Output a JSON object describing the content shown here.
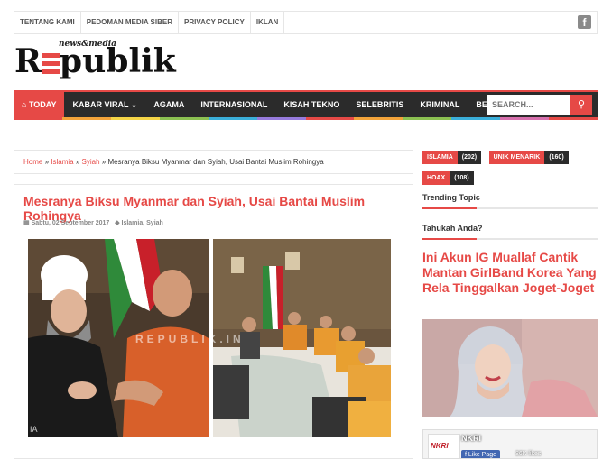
{
  "top_links": [
    "TENTANG KAMI",
    "PEDOMAN MEDIA SIBER",
    "PRIVACY POLICY",
    "IKLAN"
  ],
  "facebook_icon": "facebook-icon",
  "logo": {
    "tagline": "news&media",
    "name_prefix": "R",
    "name_suffix": "publik"
  },
  "nav": {
    "today": "TODAY",
    "items": [
      "KABAR VIRAL",
      "AGAMA",
      "INTERNASIONAL",
      "KISAH TEKNO",
      "SELEBRITIS",
      "KRIMINAL",
      "BERITA HOAX"
    ],
    "search_placeholder": "SEARCH..."
  },
  "rainbow_colors": [
    "#e64946",
    "#f2a33a",
    "#f5d547",
    "#8cc152",
    "#3bafda",
    "#967adc",
    "#e64946",
    "#f2a33a",
    "#8cc152",
    "#3bafda",
    "#d770ad",
    "#e64946"
  ],
  "breadcrumb": {
    "home": "Home",
    "sep": "»",
    "cat1": "Islamia",
    "cat2": "Syiah",
    "current": "Mesranya Biksu Myanmar dan Syiah, Usai Bantai Muslim Rohingya"
  },
  "article": {
    "title": "Mesranya Biksu Myanmar dan Syiah, Usai Bantai Muslim Rohingya",
    "date": "Sabtu, 02 September 2017",
    "tags": "Islamia, Syiah",
    "watermark": "REPUBLIK.IN",
    "corner_mark": "IA"
  },
  "sidebar": {
    "tags": [
      {
        "name": "ISLAMIA",
        "count": "(202)"
      },
      {
        "name": "UNIK MENARIK",
        "count": "(160)"
      },
      {
        "name": "HOAX",
        "count": "(108)"
      }
    ],
    "trending": "Trending Topic",
    "tahukah": "Tahukah Anda?",
    "featured_title": "Ini Akun IG Muallaf Cantik Mantan GirlBand Korea Yang Rela Tinggalkan Joget-Joget",
    "fb_page": {
      "name": "NKRI",
      "like": "Like Page",
      "likes": "86K likes",
      "logo_text": "NKRI"
    }
  }
}
